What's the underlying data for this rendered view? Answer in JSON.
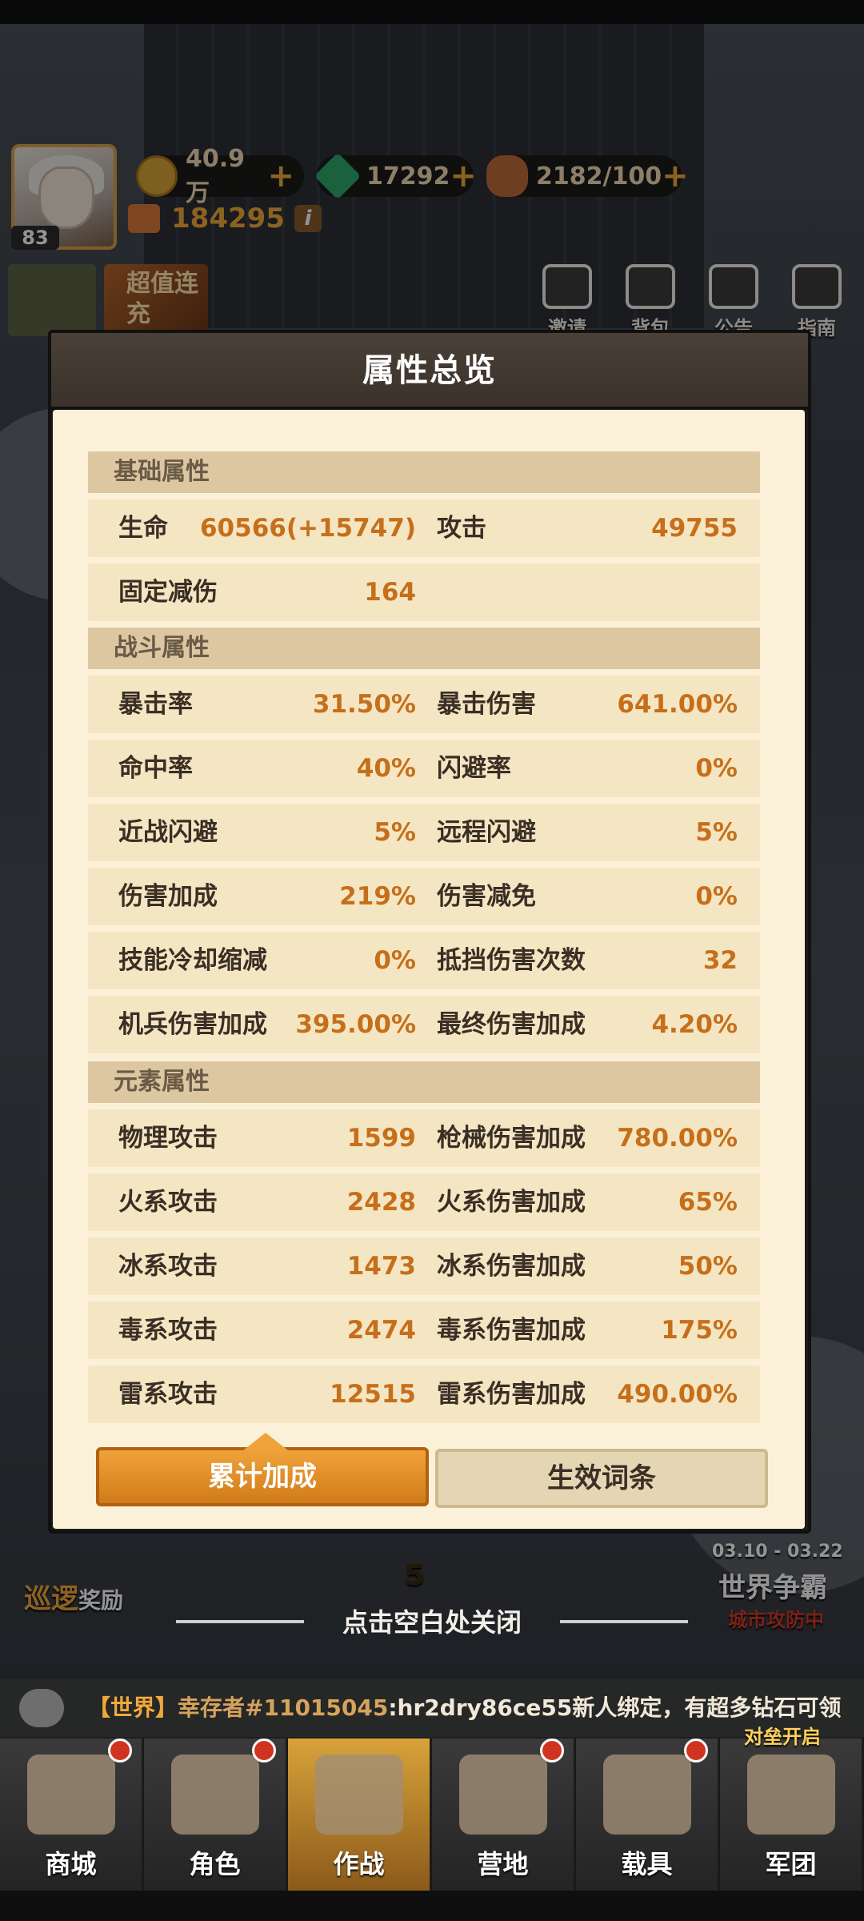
{
  "hud": {
    "level": "83",
    "gold": "40.9万",
    "gems": "17292",
    "stamina": "2182/100",
    "power": "184295",
    "info_glyph": "i"
  },
  "promo": {
    "text": "超值连充"
  },
  "top_menu": [
    {
      "label": "邀请"
    },
    {
      "label": "背包"
    },
    {
      "label": "公告"
    },
    {
      "label": "指南"
    }
  ],
  "dialog": {
    "title": "属性总览",
    "sections": [
      {
        "title": "基础属性"
      },
      {
        "title": "战斗属性"
      },
      {
        "title": "元素属性"
      }
    ],
    "basic_rows": [
      {
        "l1": "生命",
        "v1": "60566(+15747)",
        "l2": "攻击",
        "v2": "49755"
      },
      {
        "l1": "固定减伤",
        "v1": "164",
        "l2": "",
        "v2": ""
      }
    ],
    "combat_rows": [
      {
        "l1": "暴击率",
        "v1": "31.50%",
        "l2": "暴击伤害",
        "v2": "641.00%"
      },
      {
        "l1": "命中率",
        "v1": "40%",
        "l2": "闪避率",
        "v2": "0%"
      },
      {
        "l1": "近战闪避",
        "v1": "5%",
        "l2": "远程闪避",
        "v2": "5%"
      },
      {
        "l1": "伤害加成",
        "v1": "219%",
        "l2": "伤害减免",
        "v2": "0%"
      },
      {
        "l1": "技能冷却缩减",
        "v1": "0%",
        "l2": "抵挡伤害次数",
        "v2": "32"
      },
      {
        "l1": "机兵伤害加成",
        "v1": "395.00%",
        "l2": "最终伤害加成",
        "v2": "4.20%"
      }
    ],
    "element_rows": [
      {
        "l1": "物理攻击",
        "v1": "1599",
        "l2": "枪械伤害加成",
        "v2": "780.00%"
      },
      {
        "l1": "火系攻击",
        "v1": "2428",
        "l2": "火系伤害加成",
        "v2": "65%"
      },
      {
        "l1": "冰系攻击",
        "v1": "1473",
        "l2": "冰系伤害加成",
        "v2": "50%"
      },
      {
        "l1": "毒系攻击",
        "v1": "2474",
        "l2": "毒系伤害加成",
        "v2": "175%"
      },
      {
        "l1": "雷系攻击",
        "v1": "12515",
        "l2": "雷系伤害加成",
        "v2": "490.00%"
      }
    ],
    "tabs": {
      "active": "累计加成",
      "inactive": "生效词条"
    }
  },
  "behind": {
    "patrol": "巡逻",
    "reward": "奖励",
    "battle_count": "5",
    "world_event_dates": "03.10 - 03.22",
    "world_event_title": "世界争霸",
    "world_event_sub": "城市攻防中"
  },
  "close_hint": "点击空白处关闭",
  "chat": {
    "channel": "【世界】",
    "sender": "幸存者#11015045",
    "message": ":hr2dry86ce55新人绑定，有超多钻石可领"
  },
  "nav_badge": "对垒开启",
  "nav": [
    {
      "label": "商城"
    },
    {
      "label": "角色"
    },
    {
      "label": "作战"
    },
    {
      "label": "营地"
    },
    {
      "label": "载具"
    },
    {
      "label": "军团"
    }
  ],
  "colors": {
    "accent": "#c66f1b",
    "panel": "#fbf1d8",
    "row": "#f5e6c3",
    "section": "#dcc7a0",
    "tab_active": "#e08c25",
    "tab_inactive": "#e5d6b3"
  }
}
